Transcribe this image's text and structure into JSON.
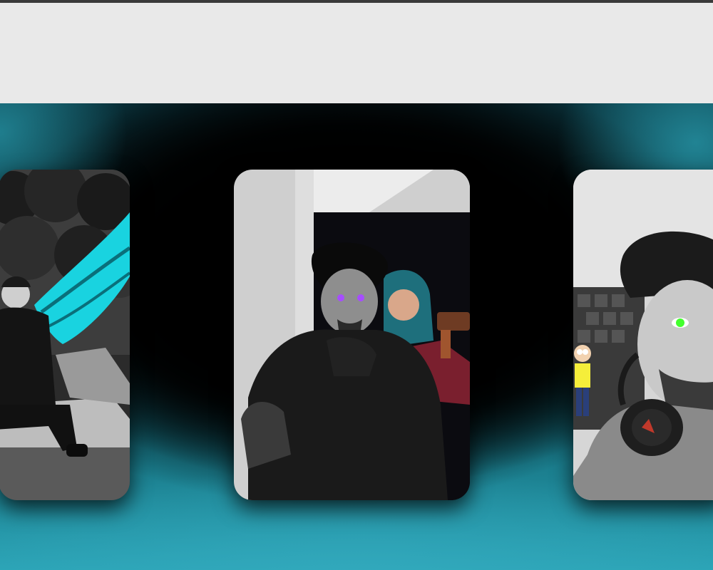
{
  "page": {
    "topbar_color": "#3a3a3a",
    "header_background": "#e9e9e9",
    "gallery_accent": "#2aa3b5"
  },
  "gallery": {
    "cards": [
      {
        "subject": "person-with-cyan-wings-photo",
        "accent": "#19d3e0"
      },
      {
        "subject": "person-with-purple-eyes-photo",
        "accent": "#a64dff"
      },
      {
        "subject": "person-with-green-eye-headphones-photo",
        "accent": "#43ff2e"
      }
    ]
  }
}
